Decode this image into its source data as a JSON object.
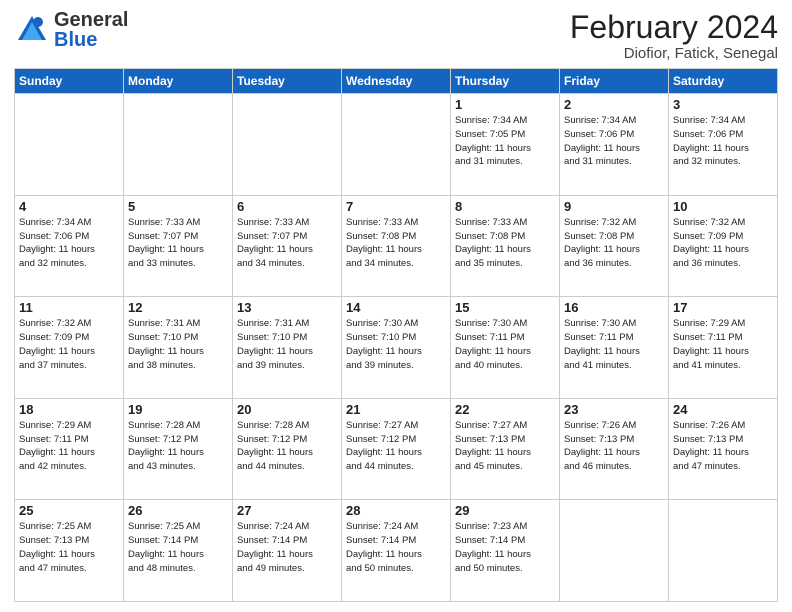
{
  "header": {
    "logo_general": "General",
    "logo_blue": "Blue",
    "title": "February 2024",
    "subtitle": "Diofior, Fatick, Senegal"
  },
  "days_of_week": [
    "Sunday",
    "Monday",
    "Tuesday",
    "Wednesday",
    "Thursday",
    "Friday",
    "Saturday"
  ],
  "weeks": [
    [
      {
        "day": "",
        "info": ""
      },
      {
        "day": "",
        "info": ""
      },
      {
        "day": "",
        "info": ""
      },
      {
        "day": "",
        "info": ""
      },
      {
        "day": "1",
        "info": "Sunrise: 7:34 AM\nSunset: 7:05 PM\nDaylight: 11 hours\nand 31 minutes."
      },
      {
        "day": "2",
        "info": "Sunrise: 7:34 AM\nSunset: 7:06 PM\nDaylight: 11 hours\nand 31 minutes."
      },
      {
        "day": "3",
        "info": "Sunrise: 7:34 AM\nSunset: 7:06 PM\nDaylight: 11 hours\nand 32 minutes."
      }
    ],
    [
      {
        "day": "4",
        "info": "Sunrise: 7:34 AM\nSunset: 7:06 PM\nDaylight: 11 hours\nand 32 minutes."
      },
      {
        "day": "5",
        "info": "Sunrise: 7:33 AM\nSunset: 7:07 PM\nDaylight: 11 hours\nand 33 minutes."
      },
      {
        "day": "6",
        "info": "Sunrise: 7:33 AM\nSunset: 7:07 PM\nDaylight: 11 hours\nand 34 minutes."
      },
      {
        "day": "7",
        "info": "Sunrise: 7:33 AM\nSunset: 7:08 PM\nDaylight: 11 hours\nand 34 minutes."
      },
      {
        "day": "8",
        "info": "Sunrise: 7:33 AM\nSunset: 7:08 PM\nDaylight: 11 hours\nand 35 minutes."
      },
      {
        "day": "9",
        "info": "Sunrise: 7:32 AM\nSunset: 7:08 PM\nDaylight: 11 hours\nand 36 minutes."
      },
      {
        "day": "10",
        "info": "Sunrise: 7:32 AM\nSunset: 7:09 PM\nDaylight: 11 hours\nand 36 minutes."
      }
    ],
    [
      {
        "day": "11",
        "info": "Sunrise: 7:32 AM\nSunset: 7:09 PM\nDaylight: 11 hours\nand 37 minutes."
      },
      {
        "day": "12",
        "info": "Sunrise: 7:31 AM\nSunset: 7:10 PM\nDaylight: 11 hours\nand 38 minutes."
      },
      {
        "day": "13",
        "info": "Sunrise: 7:31 AM\nSunset: 7:10 PM\nDaylight: 11 hours\nand 39 minutes."
      },
      {
        "day": "14",
        "info": "Sunrise: 7:30 AM\nSunset: 7:10 PM\nDaylight: 11 hours\nand 39 minutes."
      },
      {
        "day": "15",
        "info": "Sunrise: 7:30 AM\nSunset: 7:11 PM\nDaylight: 11 hours\nand 40 minutes."
      },
      {
        "day": "16",
        "info": "Sunrise: 7:30 AM\nSunset: 7:11 PM\nDaylight: 11 hours\nand 41 minutes."
      },
      {
        "day": "17",
        "info": "Sunrise: 7:29 AM\nSunset: 7:11 PM\nDaylight: 11 hours\nand 41 minutes."
      }
    ],
    [
      {
        "day": "18",
        "info": "Sunrise: 7:29 AM\nSunset: 7:11 PM\nDaylight: 11 hours\nand 42 minutes."
      },
      {
        "day": "19",
        "info": "Sunrise: 7:28 AM\nSunset: 7:12 PM\nDaylight: 11 hours\nand 43 minutes."
      },
      {
        "day": "20",
        "info": "Sunrise: 7:28 AM\nSunset: 7:12 PM\nDaylight: 11 hours\nand 44 minutes."
      },
      {
        "day": "21",
        "info": "Sunrise: 7:27 AM\nSunset: 7:12 PM\nDaylight: 11 hours\nand 44 minutes."
      },
      {
        "day": "22",
        "info": "Sunrise: 7:27 AM\nSunset: 7:13 PM\nDaylight: 11 hours\nand 45 minutes."
      },
      {
        "day": "23",
        "info": "Sunrise: 7:26 AM\nSunset: 7:13 PM\nDaylight: 11 hours\nand 46 minutes."
      },
      {
        "day": "24",
        "info": "Sunrise: 7:26 AM\nSunset: 7:13 PM\nDaylight: 11 hours\nand 47 minutes."
      }
    ],
    [
      {
        "day": "25",
        "info": "Sunrise: 7:25 AM\nSunset: 7:13 PM\nDaylight: 11 hours\nand 47 minutes."
      },
      {
        "day": "26",
        "info": "Sunrise: 7:25 AM\nSunset: 7:14 PM\nDaylight: 11 hours\nand 48 minutes."
      },
      {
        "day": "27",
        "info": "Sunrise: 7:24 AM\nSunset: 7:14 PM\nDaylight: 11 hours\nand 49 minutes."
      },
      {
        "day": "28",
        "info": "Sunrise: 7:24 AM\nSunset: 7:14 PM\nDaylight: 11 hours\nand 50 minutes."
      },
      {
        "day": "29",
        "info": "Sunrise: 7:23 AM\nSunset: 7:14 PM\nDaylight: 11 hours\nand 50 minutes."
      },
      {
        "day": "",
        "info": ""
      },
      {
        "day": "",
        "info": ""
      }
    ]
  ]
}
